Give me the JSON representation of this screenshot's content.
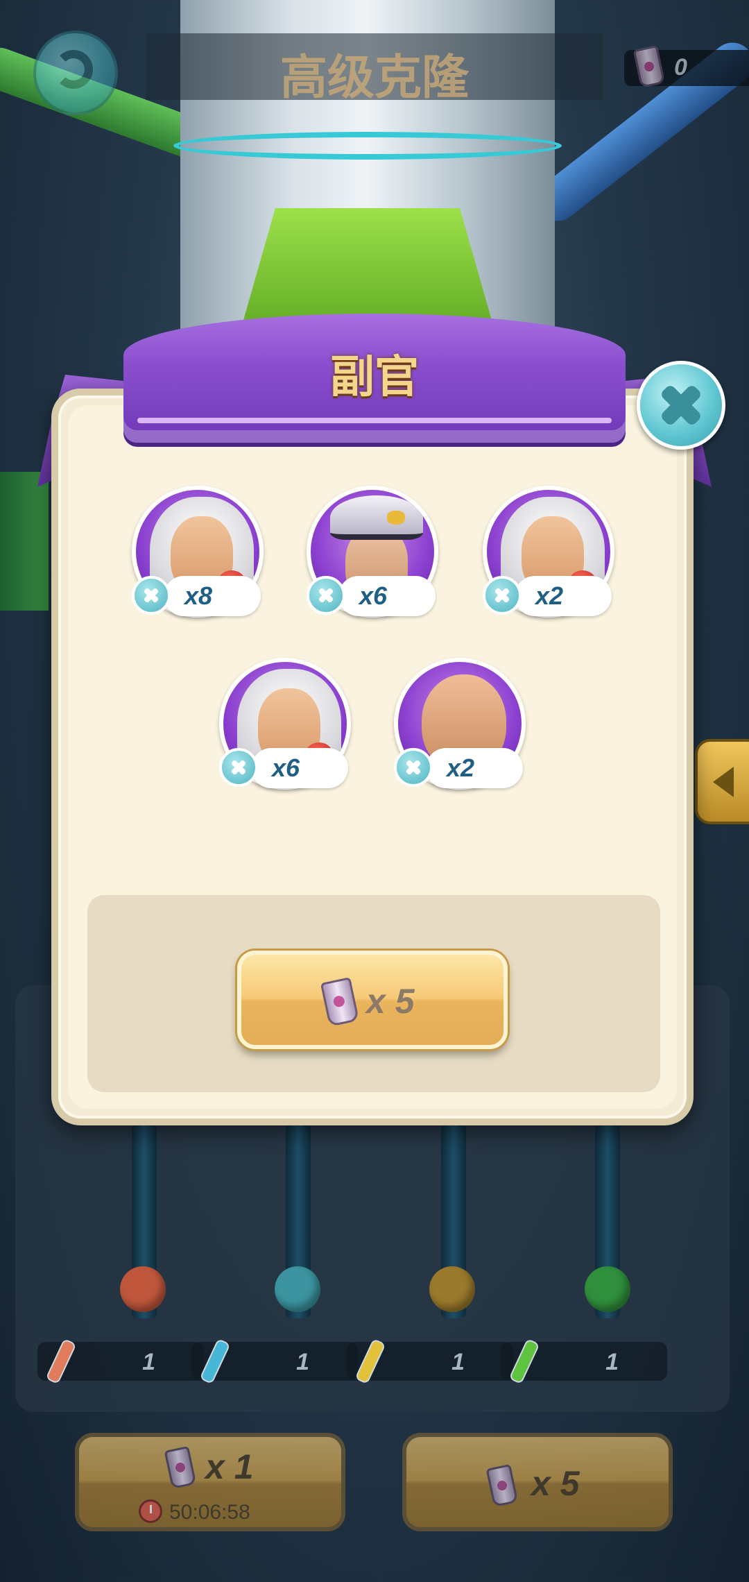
{
  "header": {
    "title": "高级克隆",
    "currency_icon": "clone-cup-icon",
    "currency_count": "0"
  },
  "dialog": {
    "title": "副官",
    "officers": [
      {
        "name": "scientist-officer",
        "count": "x8"
      },
      {
        "name": "admiral-officer",
        "count": "x6"
      },
      {
        "name": "scientist-officer",
        "count": "x2"
      },
      {
        "name": "scientist-officer",
        "count": "x6"
      },
      {
        "name": "bald-officer",
        "count": "x2"
      }
    ],
    "clone_button": {
      "icon": "clone-cup-icon",
      "cost": "x 5"
    }
  },
  "vials": [
    {
      "color": "#c0573c",
      "value": "1"
    },
    {
      "color": "#3b94a0",
      "value": "1"
    },
    {
      "color": "#9a7a2c",
      "value": "1"
    },
    {
      "color": "#2f8f3c",
      "value": "1"
    }
  ],
  "bottom_buttons": {
    "single": {
      "cost": "x 1",
      "timer": "50:06:58"
    },
    "multi": {
      "cost": "x 5"
    }
  },
  "colors": {
    "banner_purple": "#8a4fcf",
    "title_gold": "#f3d58c",
    "count_blue": "#1f5f86",
    "button_gold": "#f6c976"
  }
}
